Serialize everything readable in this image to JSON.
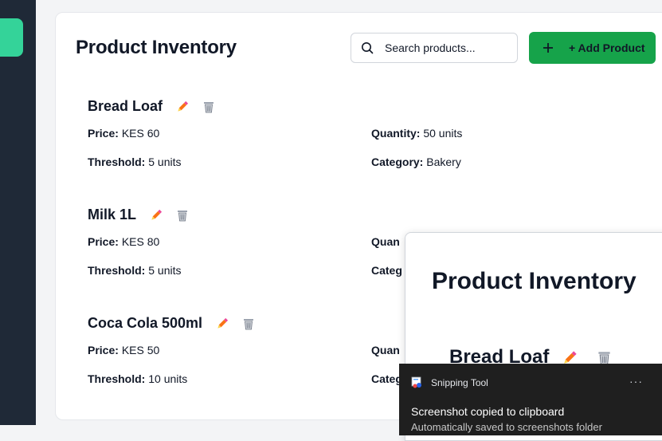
{
  "page": {
    "title": "Product Inventory"
  },
  "search": {
    "placeholder": "Search products..."
  },
  "add_button": {
    "label": "+ Add Product"
  },
  "products": [
    {
      "name": "Bread Loaf",
      "price_label": "Price:",
      "price": "KES 60",
      "quantity_label": "Quantity:",
      "quantity": "50 units",
      "threshold_label": "Threshold:",
      "threshold": "5 units",
      "category_label": "Category:",
      "category": "Bakery"
    },
    {
      "name": "Milk 1L",
      "price_label": "Price:",
      "price": "KES 80",
      "quantity_label": "Quan",
      "threshold_label": "Threshold:",
      "threshold": "5 units",
      "category_label": "Categ"
    },
    {
      "name": "Coca Cola 500ml",
      "price_label": "Price:",
      "price": "KES 50",
      "quantity_label": "Quan",
      "threshold_label": "Threshold:",
      "threshold": "10 units",
      "category_label": "Categ"
    }
  ],
  "preview": {
    "title": "Product Inventory",
    "product_name": "Bread Loaf"
  },
  "toast": {
    "app_name": "Snipping Tool",
    "more": "···",
    "message": "Screenshot copied to clipboard",
    "submessage": "Automatically saved to screenshots folder"
  },
  "colors": {
    "sidebar": "#1f2937",
    "sidebar_active": "#34d399",
    "accent": "#16a34a",
    "edit": "#f97316",
    "toast_bg": "#1f1f1f"
  }
}
